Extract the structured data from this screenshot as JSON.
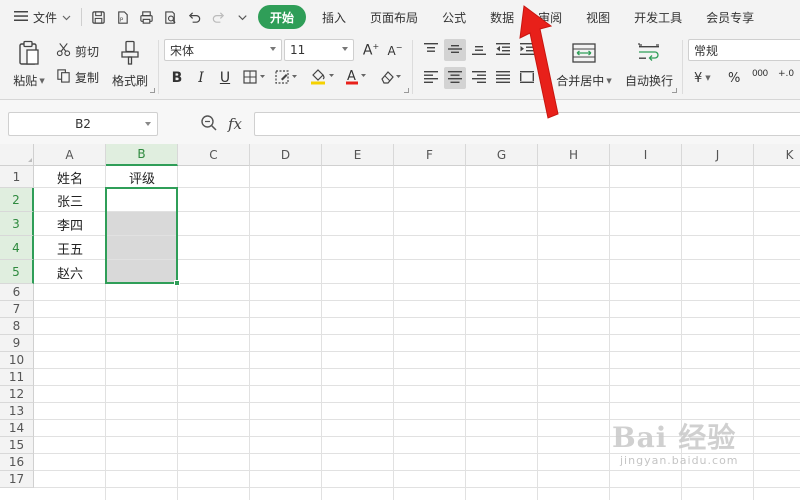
{
  "menubar": {
    "file_label": "文件",
    "tabs": [
      {
        "label": "开始",
        "active": true
      },
      {
        "label": "插入",
        "active": false
      },
      {
        "label": "页面布局",
        "active": false
      },
      {
        "label": "公式",
        "active": false
      },
      {
        "label": "数据",
        "active": false
      },
      {
        "label": "审阅",
        "active": false
      },
      {
        "label": "视图",
        "active": false
      },
      {
        "label": "开发工具",
        "active": false
      },
      {
        "label": "会员专享",
        "active": false
      }
    ]
  },
  "ribbon": {
    "paste_label": "粘贴",
    "cut_label": "剪切",
    "copy_label": "复制",
    "format_painter_label": "格式刷",
    "font_name": "宋体",
    "font_size": "11",
    "merge_center_label": "合并居中",
    "wrap_text_label": "自动换行",
    "number_format": "常规",
    "currency_symbol": "¥",
    "percent_symbol": "%",
    "thousands_symbol": "000",
    "decimal_symbol": "+.0"
  },
  "formula_bar": {
    "name_box": "B2",
    "fx_label": "fx",
    "formula_value": ""
  },
  "grid": {
    "columns": [
      "A",
      "B",
      "C",
      "D",
      "E",
      "F",
      "G",
      "H",
      "I",
      "J",
      "K"
    ],
    "selected_column": "B",
    "rows": [
      "1",
      "2",
      "3",
      "4",
      "5",
      "6",
      "7",
      "8",
      "9",
      "10",
      "11",
      "12",
      "13",
      "14",
      "15",
      "16",
      "17"
    ],
    "selected_rows": [
      "2",
      "3",
      "4",
      "5"
    ],
    "cells": {
      "A1": "姓名",
      "B1": "评级",
      "A2": "张三",
      "A3": "李四",
      "A4": "王五",
      "A5": "赵六"
    },
    "selection": "B2:B5"
  },
  "watermark": {
    "big_text": "Bai 经验",
    "small_text": "jingyan.baidu.com"
  },
  "colors": {
    "accent_green": "#2f9e58",
    "arrow_red": "#e8201a"
  }
}
